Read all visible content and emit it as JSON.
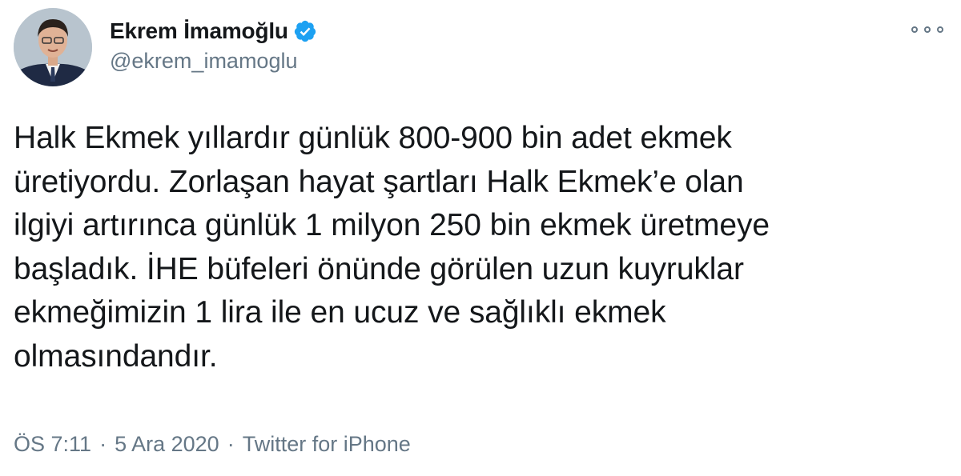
{
  "author": {
    "display_name": "Ekrem İmamoğlu",
    "handle": "@ekrem_imamoglu",
    "verified": true,
    "verified_color": "#1da1f2"
  },
  "tweet": {
    "lines": [
      "Halk Ekmek yıllardır günlük 800-900 bin adet ekmek",
      "üretiyordu. Zorlaşan hayat şartları Halk Ekmek’e olan",
      "ilgiyi artırınca günlük 1 milyon 250 bin ekmek üretmeye",
      "başladık. İHE büfeleri önünde görülen uzun kuyruklar",
      "ekmeğimizin 1 lira ile en ucuz ve sağlıklı ekmek",
      "olmasındandır."
    ]
  },
  "meta": {
    "time": "ÖS 7:11",
    "separator": "·",
    "date": "5 Ara 2020",
    "source": "Twitter for iPhone"
  },
  "icons": {
    "more": "more-options-icon",
    "verified": "verified-badge-icon"
  },
  "colors": {
    "text": "#14171a",
    "secondary": "#657786",
    "accent": "#1da1f2"
  }
}
